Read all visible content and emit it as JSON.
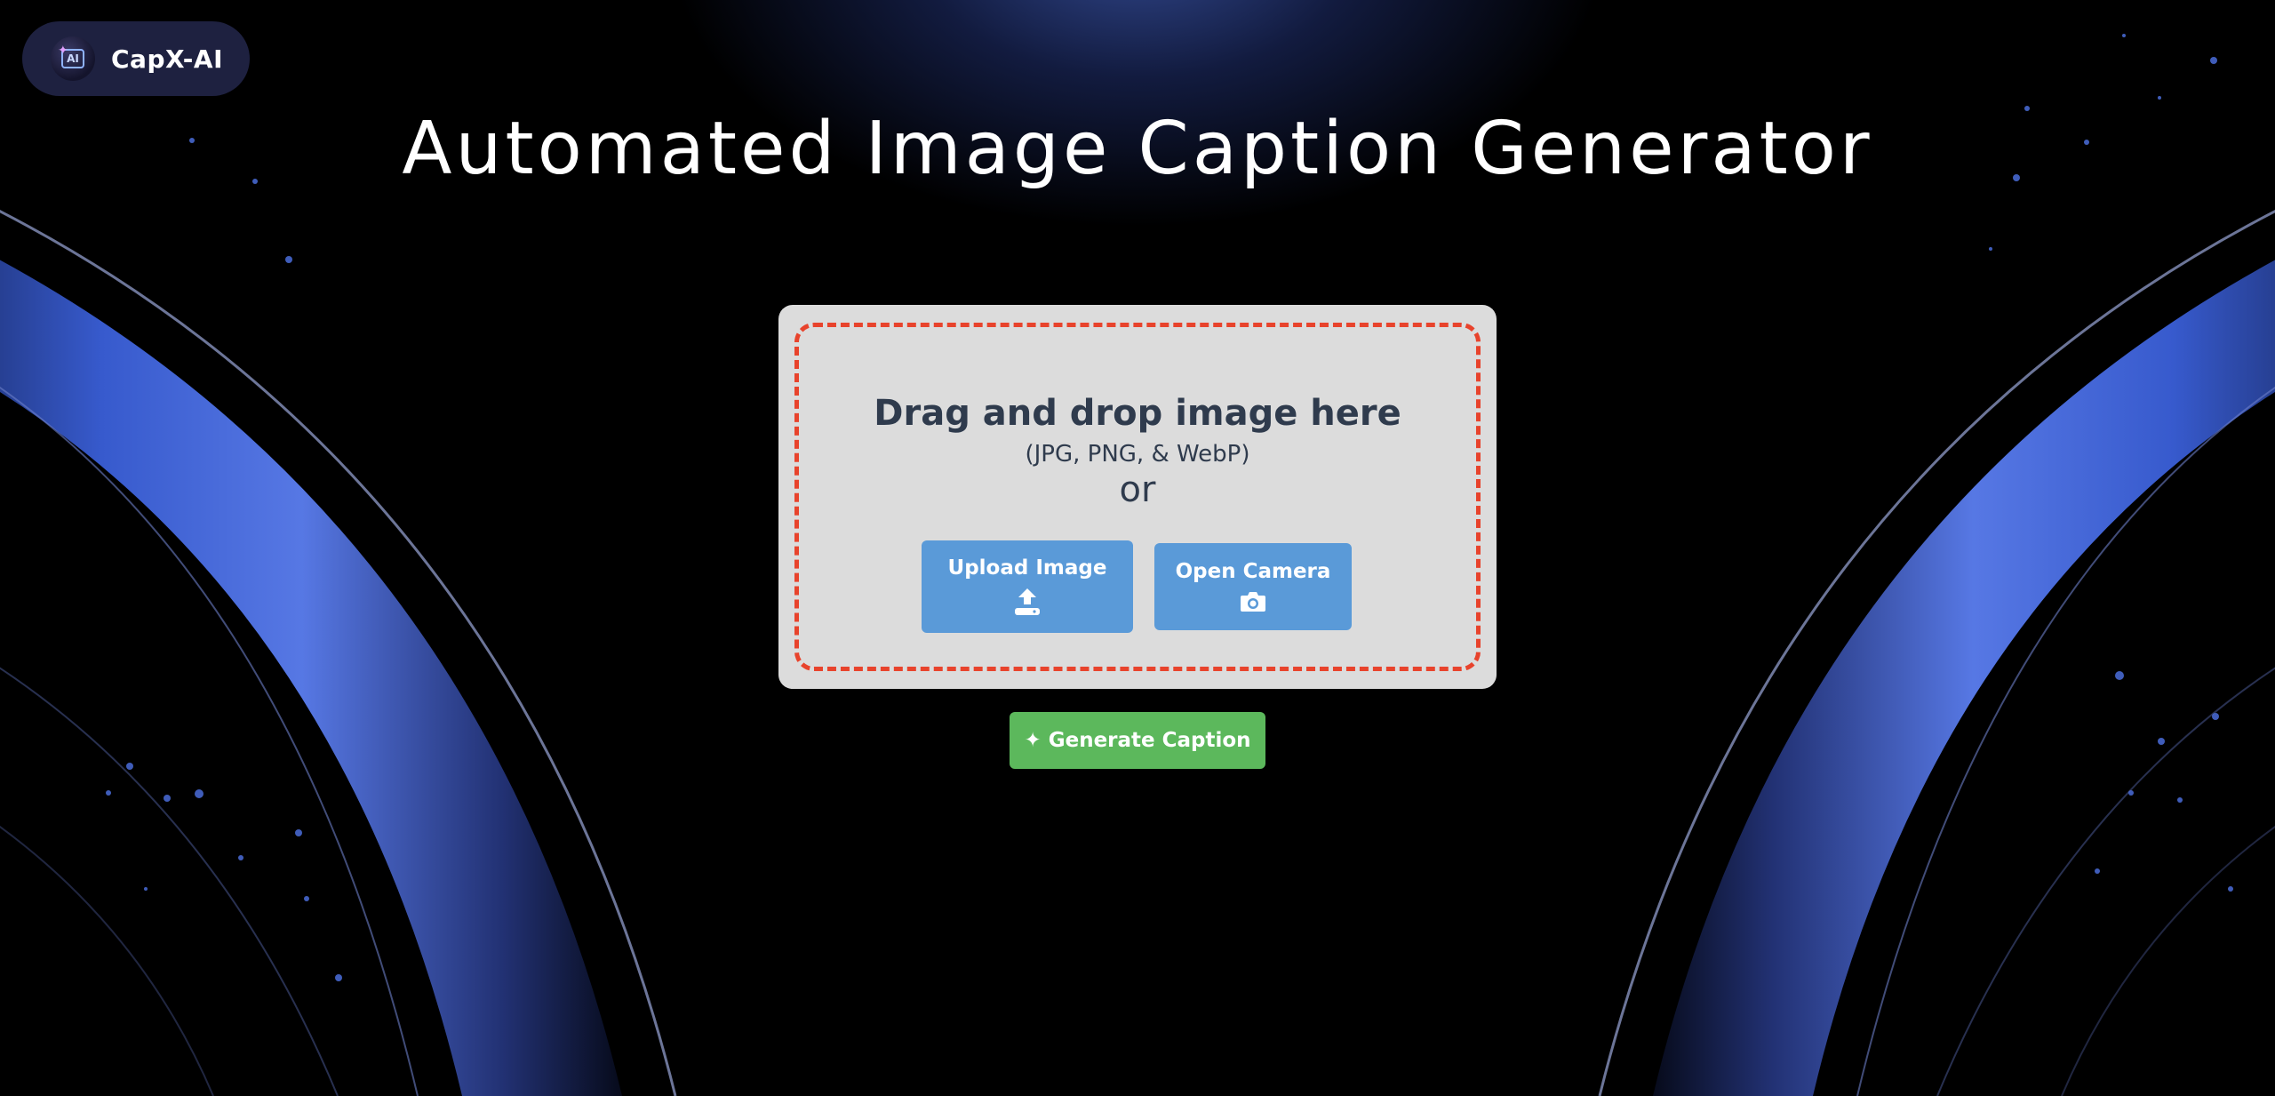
{
  "brand": {
    "name": "CapX-AI",
    "logo_text": "AI"
  },
  "page_title": "Automated Image Caption Generator",
  "dropzone": {
    "title": "Drag and drop image here",
    "formats": "(JPG, PNG, & WebP)",
    "or_text": "or"
  },
  "buttons": {
    "upload_label": "Upload Image",
    "camera_label": "Open Camera",
    "generate_label": "Generate Caption"
  },
  "colors": {
    "background": "#000000",
    "accent_blue": "#5a9ad8",
    "dropzone_border": "#e8432c",
    "generate_green": "#5cb85c",
    "card_bg": "#dcdcdc",
    "text_dark": "#2f3b4d"
  },
  "icons": {
    "upload": "upload-icon",
    "camera": "camera-icon",
    "sparkle": "sparkle-icon",
    "logo": "ai-logo-icon"
  }
}
